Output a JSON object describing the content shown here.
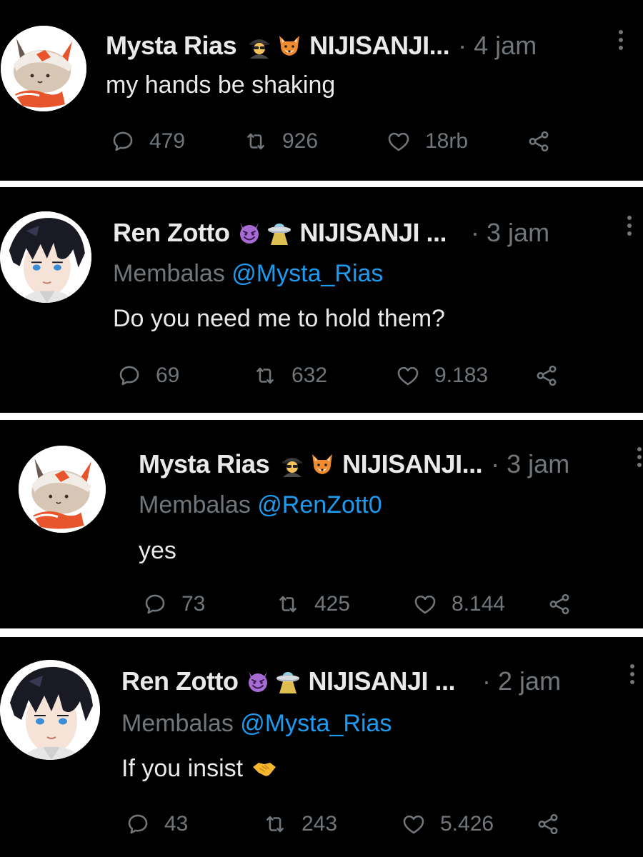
{
  "tweets": [
    {
      "name": "Mysta Rias",
      "org": "NIJISANJI...",
      "time": "· 4 jam",
      "reply_prefix": "",
      "reply_handle": "",
      "text": "my hands be shaking",
      "replies": "479",
      "retweets": "926",
      "likes": "18rb",
      "avatar": "fox-chibi-avatar",
      "emojis": [
        "detective-emoji",
        "fox-emoji"
      ]
    },
    {
      "name": "Ren Zotto",
      "org": "NIJISANJI ...",
      "time": "· 3 jam",
      "reply_prefix": "Membalas",
      "reply_handle": "@Mysta_Rias",
      "text": "Do you need me to hold them?",
      "replies": "69",
      "retweets": "632",
      "likes": "9.183",
      "avatar": "dark-hair-avatar",
      "emojis": [
        "smiling-devil-emoji",
        "ufo-emoji"
      ]
    },
    {
      "name": "Mysta Rias",
      "org": "NIJISANJI...",
      "time": "· 3 jam",
      "reply_prefix": "Membalas",
      "reply_handle": "@RenZott0",
      "text": "yes",
      "replies": "73",
      "retweets": "425",
      "likes": "8.144",
      "avatar": "fox-chibi-avatar",
      "emojis": [
        "detective-emoji",
        "fox-emoji"
      ]
    },
    {
      "name": "Ren Zotto",
      "org": "NIJISANJI ...",
      "time": "· 2 jam",
      "reply_prefix": "Membalas",
      "reply_handle": "@Mysta_Rias",
      "text": "If you insist",
      "replies": "43",
      "retweets": "243",
      "likes": "5.426",
      "avatar": "dark-hair-avatar",
      "emojis": [
        "smiling-devil-emoji",
        "ufo-emoji",
        "handshake-emoji"
      ]
    }
  ],
  "colors": {
    "background": "#000000",
    "separator": "#ffffff",
    "primary_text": "#e7e9ea",
    "secondary_text": "#71767b",
    "link": "#1d9bf0"
  }
}
